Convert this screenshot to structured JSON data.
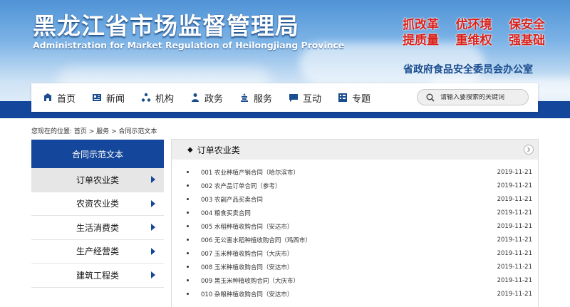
{
  "header": {
    "title": "黑龙江省市场监督管理局",
    "subtitle": "Administration for Market Regulation of Heilongjiang Province",
    "slogans": [
      [
        "抓改革",
        "优环境",
        "保安全"
      ],
      [
        "提质量",
        "重维权",
        "强基础"
      ]
    ],
    "office": "省政府食品安全委员会办公室"
  },
  "nav": {
    "items": [
      {
        "label": "首页",
        "icon": "home-icon"
      },
      {
        "label": "新闻",
        "icon": "news-icon"
      },
      {
        "label": "机构",
        "icon": "org-icon"
      },
      {
        "label": "政务",
        "icon": "gov-affairs-icon"
      },
      {
        "label": "服务",
        "icon": "service-icon"
      },
      {
        "label": "互动",
        "icon": "interaction-icon"
      },
      {
        "label": "专题",
        "icon": "topic-icon"
      }
    ],
    "search_placeholder": "请输入要搜索的关键词"
  },
  "breadcrumb": "您现在的位置:  首页 > 服务 > 合同示范文本",
  "sidebar": {
    "title": "合同示范文本",
    "items": [
      {
        "label": "订单农业类",
        "active": true
      },
      {
        "label": "农资农业类",
        "active": false
      },
      {
        "label": "生活消费类",
        "active": false
      },
      {
        "label": "生产经营类",
        "active": false
      },
      {
        "label": "建筑工程类",
        "active": false
      }
    ]
  },
  "panel": {
    "title": "订单农业类",
    "items": [
      {
        "title": "001 农业种植产销合同（哈尔滨市）",
        "date": "2019-11-21"
      },
      {
        "title": "002 农产品订单合同（参考）",
        "date": "2019-11-21"
      },
      {
        "title": "003 农副产品买卖合同",
        "date": "2019-11-21"
      },
      {
        "title": "004 粮食买卖合同",
        "date": "2019-11-21"
      },
      {
        "title": "005 水稻种植收购合同（安达市）",
        "date": "2019-11-21"
      },
      {
        "title": "006 无公害水稻种植收购合同（鸡西市）",
        "date": "2019-11-21"
      },
      {
        "title": "007 玉米种植收购合同（大庆市）",
        "date": "2019-11-21"
      },
      {
        "title": "008 玉米种植收购合同（安达市）",
        "date": "2019-11-21"
      },
      {
        "title": "009 黑玉米种植收购合同（大庆市）",
        "date": "2019-11-21"
      },
      {
        "title": "010 杂粮种植收购合同（安达市）",
        "date": "2019-11-21"
      }
    ]
  },
  "colors": {
    "primary": "#14479b",
    "slogan": "#d9221c"
  }
}
